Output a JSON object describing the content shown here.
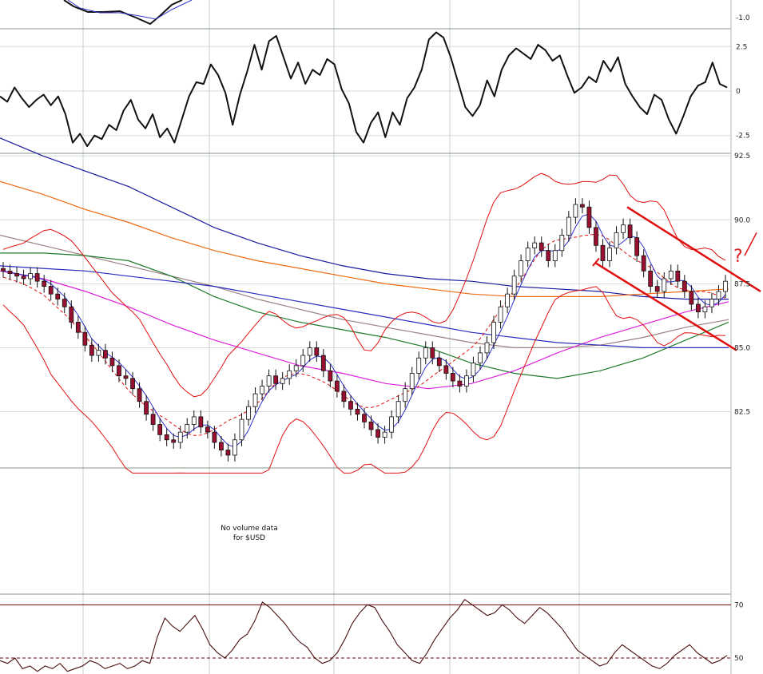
{
  "chart_data": [
    {
      "panel": "top-indicator",
      "type": "line",
      "y_ticks": [
        {
          "label": "-1.0",
          "value": -1.0
        }
      ],
      "colors": {
        "line": "#111111",
        "signal": "#3333cc"
      }
    },
    {
      "panel": "oscillator",
      "type": "line",
      "y_ticks": [
        {
          "label": "2.5",
          "value": 2.5
        },
        {
          "label": "0",
          "value": 0
        },
        {
          "label": "-2.5",
          "value": -2.5
        }
      ],
      "ylim": [
        -3.5,
        3.5
      ],
      "values": [
        -0.3,
        -0.6,
        0.2,
        -0.4,
        -0.9,
        -0.5,
        -0.2,
        -0.8,
        -0.3,
        -1.3,
        -2.9,
        -2.4,
        -3.1,
        -2.5,
        -2.7,
        -1.9,
        -2.2,
        -1.1,
        -0.5,
        -1.6,
        -2.1,
        -1.3,
        -2.6,
        -2.1,
        -2.9,
        -1.6,
        -0.3,
        0.5,
        0.4,
        1.5,
        0.9,
        -0.1,
        -1.9,
        -0.2,
        1.1,
        2.6,
        1.2,
        2.8,
        3.1,
        1.9,
        0.7,
        1.6,
        0.4,
        1.2,
        0.9,
        1.8,
        1.5,
        0.1,
        -0.7,
        -2.3,
        -2.9,
        -1.8,
        -1.2,
        -2.6,
        -1.2,
        -1.9,
        -0.4,
        0.2,
        1.2,
        2.9,
        3.3,
        3.0,
        1.9,
        0.5,
        -0.9,
        -1.4,
        -0.8,
        0.6,
        -0.3,
        1.2,
        2.0,
        2.4,
        2.1,
        1.8,
        2.6,
        2.3,
        1.7,
        2.0,
        0.9,
        -0.1,
        0.2,
        0.8,
        0.5,
        1.7,
        1.1,
        1.9,
        0.4,
        -0.3,
        -0.9,
        -1.3,
        -0.2,
        -0.5,
        -1.6,
        -2.4,
        -1.4,
        -0.3,
        0.3,
        0.5,
        1.6,
        0.4,
        0.2
      ],
      "colors": {
        "line": "#111111"
      }
    },
    {
      "panel": "price",
      "type": "candlestick",
      "symbol": "$USD",
      "y_ticks": [
        {
          "label": "92.5",
          "value": 92.5
        },
        {
          "label": "90.0",
          "value": 90.0
        },
        {
          "label": "87.5",
          "value": 87.5
        },
        {
          "label": "85.0",
          "value": 85.0
        },
        {
          "label": "82.5",
          "value": 82.5
        }
      ],
      "ylim": [
        80.3,
        92.6
      ],
      "closes": [
        88.0,
        87.9,
        87.8,
        87.7,
        87.9,
        87.6,
        87.4,
        87.1,
        86.9,
        86.6,
        86.0,
        85.6,
        85.1,
        84.7,
        84.9,
        84.6,
        84.3,
        83.9,
        83.8,
        83.4,
        82.9,
        82.4,
        82.0,
        81.6,
        81.4,
        81.3,
        81.7,
        82.0,
        82.3,
        81.9,
        81.7,
        81.3,
        81.0,
        80.8,
        81.4,
        82.2,
        82.7,
        83.2,
        83.5,
        83.9,
        83.6,
        83.8,
        84.1,
        84.3,
        84.7,
        85.0,
        84.7,
        84.1,
        83.7,
        83.3,
        82.9,
        82.6,
        82.4,
        82.1,
        81.8,
        81.5,
        81.7,
        82.3,
        82.9,
        83.4,
        84.0,
        84.6,
        85.0,
        84.6,
        84.3,
        84.0,
        83.7,
        83.5,
        83.9,
        84.4,
        84.8,
        85.2,
        86.0,
        86.6,
        87.1,
        87.8,
        88.4,
        88.9,
        89.1,
        88.8,
        88.4,
        88.8,
        89.4,
        90.1,
        90.6,
        90.5,
        89.7,
        89.0,
        88.4,
        88.9,
        89.5,
        89.8,
        89.3,
        88.6,
        88.0,
        87.4,
        87.2,
        87.7,
        88.0,
        87.6,
        87.2,
        86.7,
        86.4,
        86.6,
        86.9,
        87.2,
        87.6
      ],
      "moving_averages": [
        {
          "color": "#1a1aa0",
          "values": [
            93.2,
            92.5,
            91.9,
            91.3,
            90.5,
            89.7,
            89.1,
            88.6,
            88.2,
            87.9,
            87.7,
            87.6,
            87.4,
            87.3,
            87.2,
            87.0,
            86.9,
            86.9
          ]
        },
        {
          "color": "#ee6a10",
          "values": [
            91.5,
            91.0,
            90.4,
            89.9,
            89.3,
            88.8,
            88.4,
            88.1,
            87.8,
            87.5,
            87.3,
            87.1,
            87.0,
            87.0,
            87.0,
            87.1,
            87.2,
            87.3
          ]
        },
        {
          "color": "#9a8080",
          "values": [
            89.4,
            89.0,
            88.6,
            88.2,
            87.8,
            87.4,
            86.9,
            86.5,
            86.1,
            85.8,
            85.5,
            85.2,
            85.0,
            85.0,
            85.1,
            85.4,
            85.8,
            86.1
          ]
        },
        {
          "color": "#1e7a2c",
          "values": [
            88.7,
            88.7,
            88.6,
            88.4,
            87.8,
            87.0,
            86.4,
            86.0,
            85.7,
            85.4,
            85.0,
            84.4,
            84.0,
            83.8,
            84.1,
            84.6,
            85.3,
            86.0
          ]
        },
        {
          "color": "#dd22dd",
          "values": [
            88.0,
            87.7,
            87.2,
            86.6,
            85.9,
            85.3,
            84.8,
            84.3,
            84.0,
            83.6,
            83.4,
            83.6,
            84.1,
            84.8,
            85.4,
            85.9,
            86.4,
            86.8
          ]
        },
        {
          "color": "#2a2ac0",
          "values": [
            88.2,
            88.1,
            88.0,
            87.8,
            87.6,
            87.4,
            87.1,
            86.8,
            86.5,
            86.2,
            85.9,
            85.6,
            85.4,
            85.2,
            85.1,
            85.0,
            85.0,
            85.0
          ]
        }
      ],
      "bollinger": {
        "color": "#e01010"
      },
      "annotations": {
        "channel_color": "#e01010",
        "question_mark": "?"
      },
      "volume_note": [
        "No volume data",
        "for $USD"
      ]
    },
    {
      "panel": "bottom-indicator",
      "type": "line",
      "y_ticks": [
        {
          "label": "70",
          "value": 70
        },
        {
          "label": "50",
          "value": 50
        }
      ],
      "ylim": [
        44,
        74
      ],
      "values": [
        49,
        48,
        50,
        46,
        47,
        45,
        47,
        46,
        48,
        45,
        46,
        47,
        49,
        48,
        46,
        47,
        48,
        46,
        47,
        49,
        48,
        58,
        65,
        62,
        60,
        63,
        66,
        61,
        55,
        52,
        50,
        53,
        57,
        59,
        64,
        71,
        69,
        66,
        63,
        59,
        56,
        54,
        50,
        48,
        49,
        52,
        57,
        63,
        67,
        70,
        69,
        64,
        60,
        55,
        52,
        49,
        48,
        52,
        57,
        61,
        65,
        68,
        72,
        70,
        68,
        66,
        67,
        70,
        68,
        65,
        63,
        66,
        69,
        67,
        64,
        61,
        57,
        53,
        51,
        49,
        47,
        48,
        52,
        55,
        53,
        51,
        49,
        47,
        46,
        48,
        51,
        53,
        55,
        52,
        50,
        48,
        49,
        51
      ],
      "colors": {
        "line": "#4a1010",
        "level": "#6a0000"
      }
    }
  ]
}
